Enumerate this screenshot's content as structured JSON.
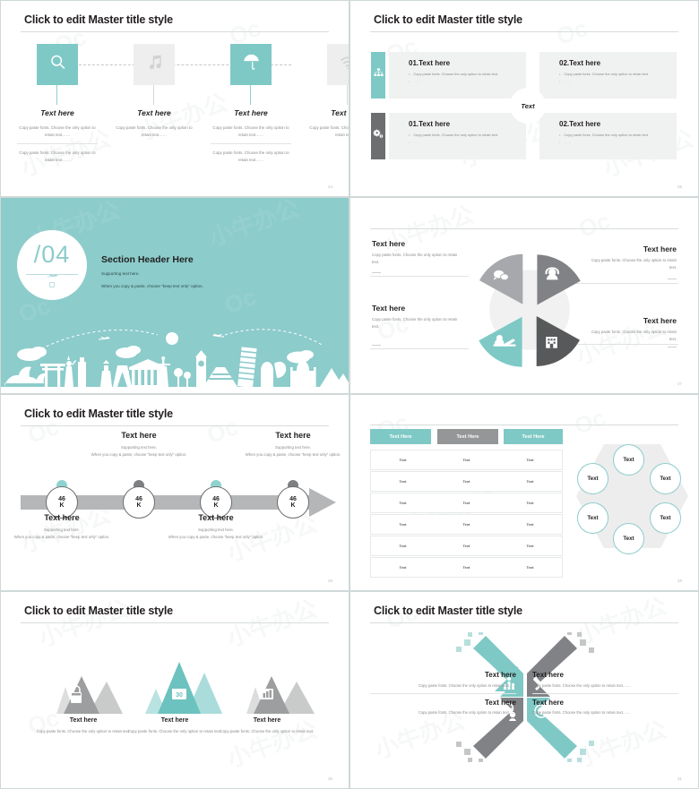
{
  "deck": {
    "theme": {
      "teal": "#7ec9c6",
      "teal_light": "#8ccccb",
      "teal_pale": "#b3e0de",
      "gray": "#808285",
      "gray_dark": "#636466",
      "gray_light": "#c7c9c9",
      "gray_pale": "#e6e7e7",
      "ink": "#231f20"
    },
    "common_title": "Click to edit Master title style",
    "watermark": "Oc 小牛办公"
  },
  "slide1": {
    "title": "Click to edit Master title style",
    "page": "24",
    "items": [
      {
        "icon": "search-icon",
        "color": "teal",
        "heading": "Text here",
        "body1": "Copy paste fonts. Choose the only option to retain text……",
        "body2": "Copy paste fonts. Choose the only option to retain text……"
      },
      {
        "icon": "music-note-icon",
        "color": "gray",
        "heading": "Text here",
        "body1": "Copy paste fonts. Choose the only option to retain text……",
        "body2": ""
      },
      {
        "icon": "umbrella-icon",
        "color": "teal",
        "heading": "Text here",
        "body1": "Copy paste fonts. Choose the only option to retain text……",
        "body2": "Copy paste fonts. Choose the only option to retain text……"
      },
      {
        "icon": "wifi-icon",
        "color": "gray",
        "heading": "Text here",
        "body1": "Copy paste fonts. Choose the only option to retain text……",
        "body2": ""
      }
    ]
  },
  "slide2": {
    "title": "Click to edit Master title style",
    "page": "25",
    "center_label": "Text",
    "cards": [
      {
        "icon": "org-chart-icon",
        "tab_color": "teal",
        "heading": "01.Text here",
        "bullet1": "Copy paste fonts. Choose the only option to retain text.",
        "bullet2": "……"
      },
      {
        "icon": "",
        "tab_color": "none",
        "heading": "02.Text here",
        "bullet1": "Copy paste fonts. Choose the only option to retain text.",
        "bullet2": "……"
      },
      {
        "icon": "gears-icon",
        "tab_color": "gray",
        "heading": "01.Text here",
        "bullet1": "Copy paste fonts. Choose the only option to retain text.",
        "bullet2": "……"
      },
      {
        "icon": "",
        "tab_color": "none",
        "heading": "02.Text here",
        "bullet1": "Copy paste fonts. Choose the only option to retain text.",
        "bullet2": "……"
      }
    ]
  },
  "slide3": {
    "number": "/04",
    "heading": "Section Header Here",
    "sub1": "Supporting text here.",
    "sub2": "When you copy & paste, choose \"keep text only\" option."
  },
  "slide4": {
    "page": "27",
    "blocks": [
      {
        "heading": "Text here",
        "body": "Copy paste fonts. Choose the only option to retain text.",
        "align": "left",
        "pos": "top-left"
      },
      {
        "heading": "Text here",
        "body": "Copy paste fonts. Choose the only option to retain text.",
        "align": "right",
        "pos": "top-right"
      },
      {
        "heading": "Text here",
        "body": "Copy paste fonts. Choose the only option to retain text.",
        "align": "left",
        "pos": "bottom-left"
      },
      {
        "heading": "Text here",
        "body": "Copy paste fonts. Choose the only option to retain text.",
        "align": "right",
        "pos": "bottom-right"
      }
    ],
    "chart_data": {
      "type": "pie",
      "title": "",
      "categories": [
        "Chat",
        "Support",
        "Office",
        "Workspace"
      ],
      "values": [
        25,
        25,
        25,
        25
      ],
      "colors": [
        "#a6a8ab",
        "#808285",
        "#58595b",
        "#7ec9c6"
      ],
      "icons": [
        "chat-bubbles-icon",
        "headset-person-icon",
        "office-building-icon",
        "person-laptop-icon"
      ],
      "legend": "off",
      "grid": "off",
      "exploded": true
    }
  },
  "slide5": {
    "title": "Click to edit Master title style",
    "page": "28",
    "nodes": [
      {
        "value": "46",
        "unit": "K",
        "dot": "teal"
      },
      {
        "value": "46",
        "unit": "K",
        "dot": "gray"
      },
      {
        "value": "46",
        "unit": "K",
        "dot": "teal"
      },
      {
        "value": "46",
        "unit": "K",
        "dot": "gray"
      }
    ],
    "captions": [
      {
        "heading": "Text here",
        "line1": "Supporting text here.",
        "line2": "When you copy & paste, choose \"keep text only\" option.",
        "side": "below"
      },
      {
        "heading": "Text here",
        "line1": "Supporting text here.",
        "line2": "When you copy & paste, choose \"keep text only\" option.",
        "side": "above"
      },
      {
        "heading": "Text here",
        "line1": "Supporting text here.",
        "line2": "When you copy & paste, choose \"keep text only\" option.",
        "side": "below"
      },
      {
        "heading": "Text here",
        "line1": "Supporting text here.",
        "line2": "When you copy & paste, choose \"keep text only\" option.",
        "side": "above"
      }
    ]
  },
  "slide6": {
    "page": "29",
    "table": {
      "headers": [
        {
          "label": "Text Here",
          "color": "teal"
        },
        {
          "label": "Text Here",
          "color": "gray"
        },
        {
          "label": "Text Here",
          "color": "teal"
        }
      ],
      "rows": [
        [
          "Text",
          "Text",
          "Text"
        ],
        [
          "Text",
          "Text",
          "Text"
        ],
        [
          "Text",
          "Text",
          "Text"
        ],
        [
          "Text",
          "Text",
          "Text"
        ],
        [
          "Text",
          "Text",
          "Text"
        ],
        [
          "Text",
          "Text",
          "Text"
        ]
      ]
    },
    "circles": [
      "Text",
      "Text",
      "Text",
      "Text",
      "Text",
      "Text"
    ]
  },
  "slide7": {
    "title": "Click to edit Master title style",
    "page": "30",
    "groups": [
      {
        "icon": "shopping-bag-icon",
        "color": "gray",
        "heading": "Text here",
        "body": "Copy paste fonts. Choose the only option to retain text."
      },
      {
        "icon": "calendar-30-icon",
        "color": "teal",
        "heading": "Text here",
        "body": "Copy paste fonts. Choose the only option to retain text."
      },
      {
        "icon": "chart-report-icon",
        "color": "gray",
        "heading": "Text here",
        "body": "Copy paste fonts. Choose the only option to retain text."
      }
    ]
  },
  "slide8": {
    "title": "Click to edit Master title style",
    "page": "31",
    "quadrants": [
      {
        "icon": "people-group-icon",
        "color": "teal",
        "heading": "Text here",
        "body": "Copy paste fonts. Choose the only option to retain text……",
        "pos": "top-left"
      },
      {
        "icon": "tools-icon",
        "color": "gray",
        "heading": "Text here",
        "body": "Copy paste fonts. Choose the only option to retain text……",
        "pos": "top-right"
      },
      {
        "icon": "user-globe-icon",
        "color": "gray",
        "heading": "Text here",
        "body": "Copy paste fonts. Choose the only option to retain text……",
        "pos": "bottom-left"
      },
      {
        "icon": "target-icon",
        "color": "teal",
        "heading": "Text here",
        "body": "Copy paste fonts. Choose the only option to retain text……",
        "pos": "bottom-right"
      }
    ]
  }
}
